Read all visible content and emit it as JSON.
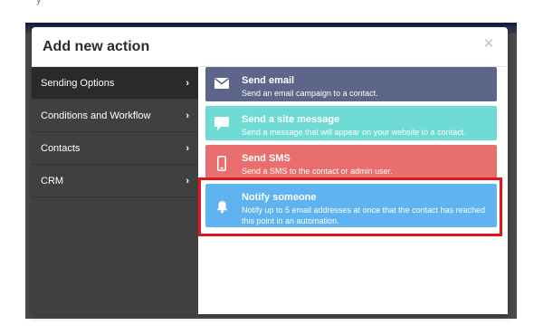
{
  "top_fragment": "y",
  "modal": {
    "title": "Add new action",
    "close_glyph": "×"
  },
  "sidebar": {
    "items": [
      {
        "label": "Sending Options",
        "active": true
      },
      {
        "label": "Conditions and Workflow",
        "active": false
      },
      {
        "label": "Contacts",
        "active": false
      },
      {
        "label": "CRM",
        "active": false
      }
    ]
  },
  "actions": [
    {
      "title": "Send email",
      "desc": "Send an email campaign to a contact.",
      "icon": "envelope-icon",
      "color": "#5d6688"
    },
    {
      "title": "Send a site message",
      "desc": "Send a message that will appear on your website to a contact.",
      "icon": "chat-bubble-icon",
      "color": "#6fdbd5"
    },
    {
      "title": "Send SMS",
      "desc": "Send a SMS to the contact or admin user.",
      "icon": "mobile-phone-icon",
      "color": "#e96f6e"
    },
    {
      "title": "Notify someone",
      "desc": "Notify up to 5 email addresses at once that the contact has reached this point in an automation.",
      "icon": "bell-icon",
      "color": "#5fb3f0"
    }
  ],
  "highlight_color": "#e0151e"
}
